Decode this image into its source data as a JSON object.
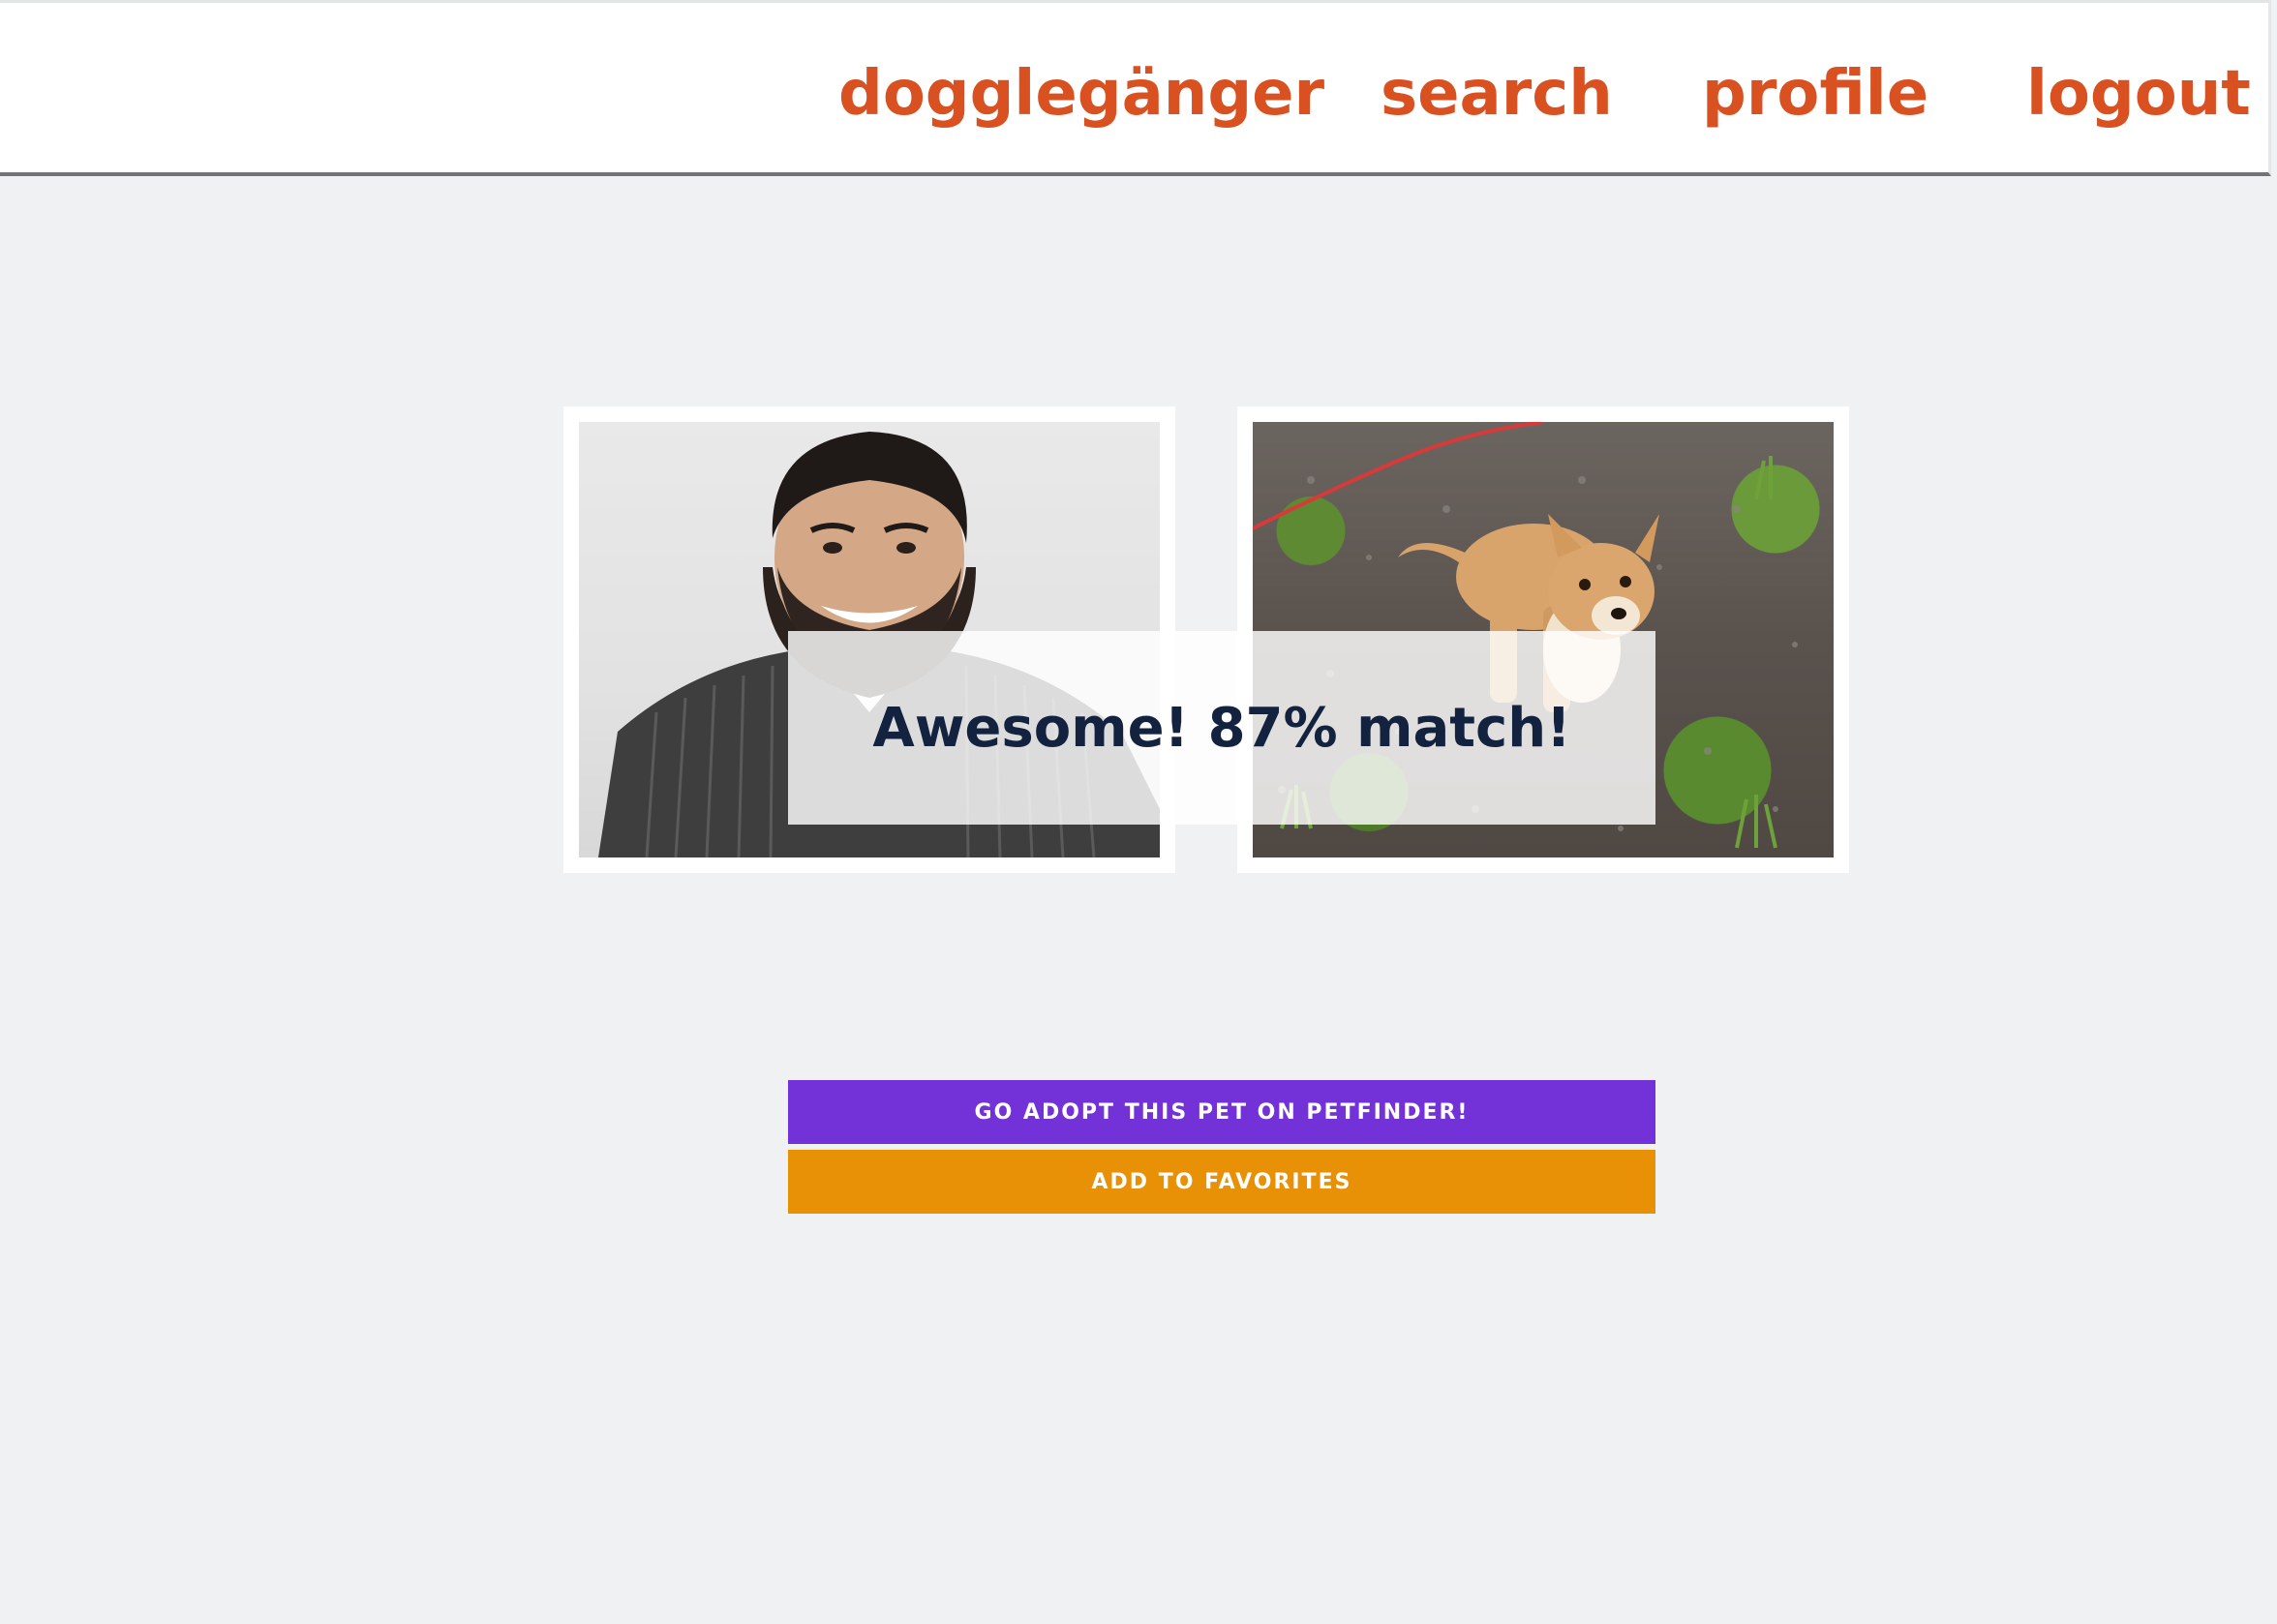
{
  "nav": {
    "brand": "dogglegänger",
    "search": "search",
    "profile": "profile",
    "logout": "logout"
  },
  "match": {
    "message": "Awesome! 87% match!"
  },
  "actions": {
    "adopt_label": "GO ADOPT THIS PET ON PETFINDER!",
    "favorite_label": "ADD TO FAVORITES"
  },
  "colors": {
    "nav_link": "#da5121",
    "adopt_button": "#7232d8",
    "favorite_button": "#e89006",
    "match_text": "#13223f",
    "page_background": "#f0f1f3"
  }
}
